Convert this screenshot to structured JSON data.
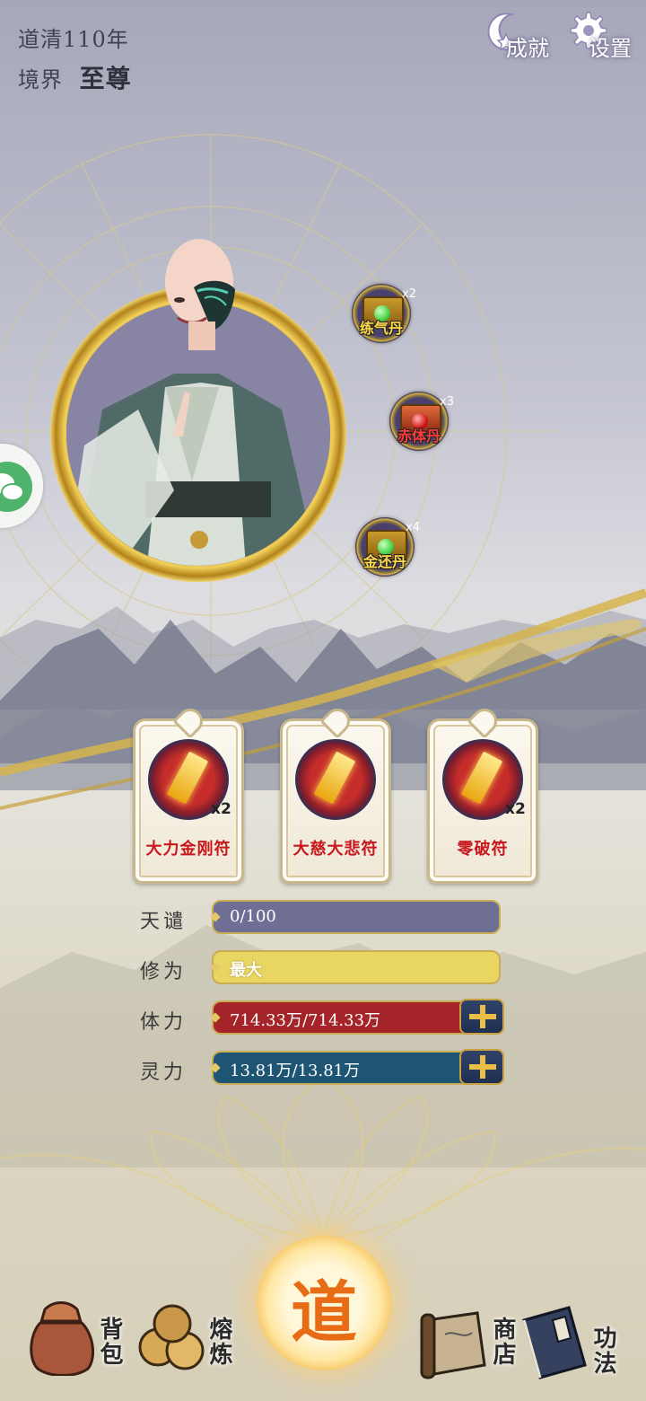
{
  "hud": {
    "dao_age": "道清110年",
    "realm_label": "境界",
    "realm_value": "至尊"
  },
  "top_buttons": {
    "achievement": "成就",
    "settings": "设置"
  },
  "pills": [
    {
      "name": "练气丹",
      "count": "x2",
      "orb_color": "#4fd34a",
      "name_color": "#ffd94d"
    },
    {
      "name": "赤体丹",
      "count": "x3",
      "orb_color": "#d61a1a",
      "name_color": "#ff3b3b"
    },
    {
      "name": "金还丹",
      "count": "x4",
      "orb_color": "#49d24c",
      "name_color": "#ffd94d"
    }
  ],
  "talismans": [
    {
      "name": "大力金刚符",
      "count": "x2"
    },
    {
      "name": "大慈大悲符",
      "count": ""
    },
    {
      "name": "零破符",
      "count": "x2"
    }
  ],
  "stats": {
    "tribulation": {
      "label": "天谴",
      "value": "0/100",
      "color": "#6f6f95"
    },
    "cultivation": {
      "label": "修为",
      "value": "最大",
      "color": "#e8d562"
    },
    "stamina": {
      "label": "体力",
      "value": "714.33万/714.33万",
      "color": "#a5242a"
    },
    "spirit": {
      "label": "灵力",
      "value": "13.81万/13.81万",
      "color": "#1e5573"
    }
  },
  "bottom_nav": {
    "bag": "背包",
    "refine": "熔炼",
    "dao": "道",
    "shop": "商店",
    "skills": "功法"
  }
}
